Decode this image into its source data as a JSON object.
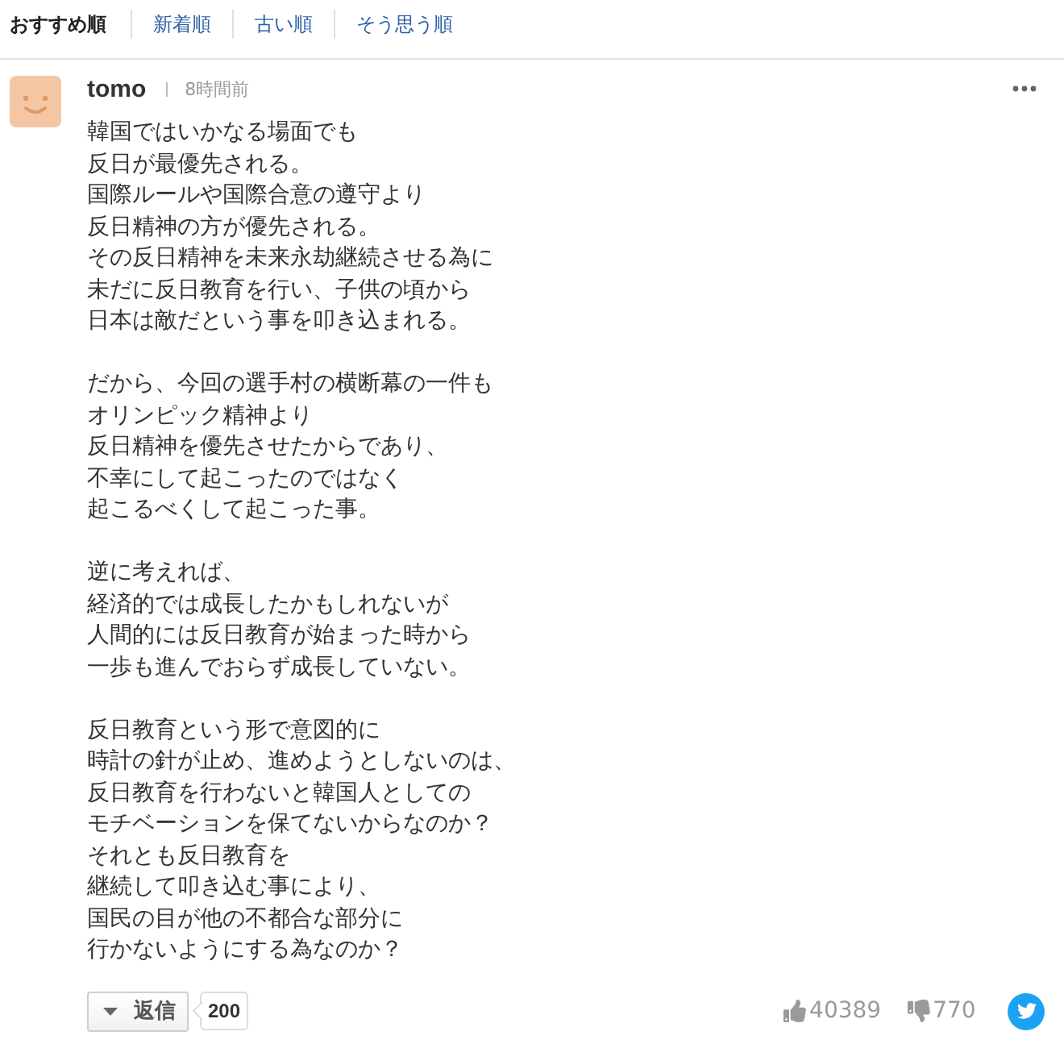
{
  "sort_tabs": [
    {
      "label": "おすすめ順",
      "selected": true
    },
    {
      "label": "新着順",
      "selected": false
    },
    {
      "label": "古い順",
      "selected": false
    },
    {
      "label": "そう思う順",
      "selected": false
    }
  ],
  "comment": {
    "author": "tomo",
    "time": "8時間前",
    "paragraphs": [
      [
        "韓国ではいかなる場面でも",
        "反日が最優先される。",
        "国際ルールや国際合意の遵守より",
        "反日精神の方が優先される。",
        "その反日精神を未来永劫継続させる為に",
        "未だに反日教育を行い、子供の頃から",
        "日本は敵だという事を叩き込まれる。"
      ],
      [
        "だから、今回の選手村の横断幕の一件も",
        "オリンピック精神より",
        "反日精神を優先させたからであり、",
        "不幸にして起こったのではなく",
        "起こるべくして起こった事。"
      ],
      [
        "逆に考えれば、",
        "経済的では成長したかもしれないが",
        "人間的には反日教育が始まった時から",
        "一歩も進んでおらず成長していない。"
      ],
      [
        "反日教育という形で意図的に",
        "時計の針が止め、進めようとしないのは、",
        "反日教育を行わないと韓国人としての",
        "モチベーションを保てないからなのか？",
        "それとも反日教育を",
        "継続して叩き込む事により、",
        "国民の目が他の不都合な部分に",
        "行かないようにする為なのか？"
      ]
    ],
    "reply_button": "返信",
    "reply_count": "200",
    "likes": "40389",
    "dislikes": "770"
  }
}
